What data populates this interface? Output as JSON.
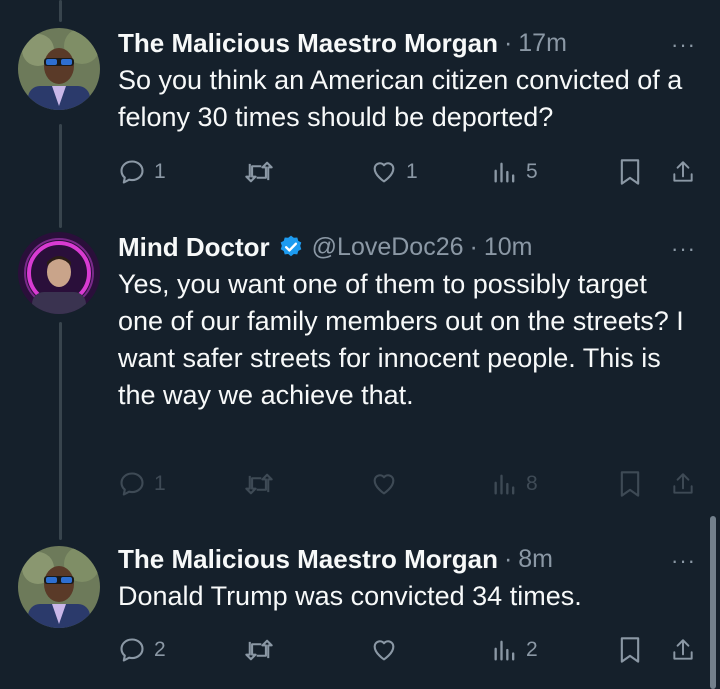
{
  "tweets": [
    {
      "name": "The Malicious Maestro Morgan",
      "handle": "",
      "separator": "·",
      "time": "17m",
      "verified": false,
      "more": "···",
      "text": "So you think an American citizen convicted of a felony 30 times should be deported?",
      "replies": "1",
      "retweets": "",
      "likes": "1",
      "views": "5",
      "actions_faded": false
    },
    {
      "name": "Mind Doctor",
      "handle": "@LoveDoc26",
      "separator": "·",
      "time": "10m",
      "verified": true,
      "more": "···",
      "text": "Yes, you want one of them to possibly target one of our family members out on the streets? I want safer streets for innocent people. This is the way we achieve that.",
      "replies": "1",
      "retweets": "",
      "likes": "",
      "views": "8",
      "actions_faded": true
    },
    {
      "name": "The Malicious Maestro Morgan",
      "handle": "",
      "separator": "·",
      "time": "8m",
      "verified": false,
      "more": "···",
      "text": "Donald Trump was convicted 34 times.",
      "replies": "2",
      "retweets": "",
      "likes": "",
      "views": "2",
      "actions_faded": false
    }
  ],
  "colors": {
    "background": "#15202b",
    "text": "#f7f9f9",
    "muted": "#8b98a5",
    "verified": "#1d9bf0",
    "thread_line": "#38444d"
  },
  "icons": [
    "reply-icon",
    "retweet-icon",
    "like-icon",
    "views-icon",
    "bookmark-icon",
    "share-icon",
    "more-icon",
    "verified-badge-icon"
  ]
}
